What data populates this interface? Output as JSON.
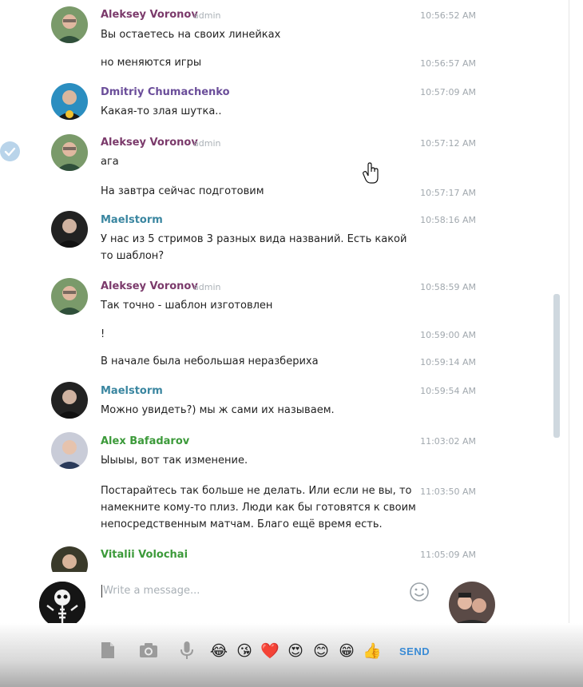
{
  "colors": {
    "author_purple": "#7b3a6b",
    "author_violet": "#6b4e9a",
    "author_teal": "#3a86a0",
    "author_green": "#3c9a3a",
    "time_gray": "#a1a8ae",
    "accent_blue": "#3a8bd5"
  },
  "messages": [
    {
      "author": "Aleksey Voronov",
      "role": "admin",
      "time": "10:56:52 AM",
      "text": "Вы остаетесь на своих линейках"
    },
    {
      "time": "10:56:57 AM",
      "text": "но меняются игры"
    },
    {
      "author": "Dmitriy Chumachenko",
      "time": "10:57:09 AM",
      "text": "Какая-то злая шутка.."
    },
    {
      "author": "Aleksey Voronov",
      "role": "admin",
      "time": "10:57:12 AM",
      "text": "ага"
    },
    {
      "time": "10:57:17 AM",
      "text": "На завтра сейчас подготовим"
    },
    {
      "author": "Maelstorm",
      "time": "10:58:16 AM",
      "text": "У нас из 5 стримов 3 разных вида названий. Есть какой то шаблон?"
    },
    {
      "author": "Aleksey Voronov",
      "role": "admin",
      "time": "10:58:59 AM",
      "text": "Так точно - шаблон изготовлен"
    },
    {
      "time": "10:59:00 AM",
      "text": "!"
    },
    {
      "time": "10:59:14 AM",
      "text": "В начале была небольшая неразбериха"
    },
    {
      "author": "Maelstorm",
      "time": "10:59:54 AM",
      "text": "Можно увидеть?) мы ж сами их называем."
    },
    {
      "author": "Alex Bafadarov",
      "time": "11:03:02 AM",
      "text": "Ыыыы, вот так изменение."
    },
    {
      "time": "11:03:50 AM",
      "text": "Постарайтесь так больше не делать. Или если не вы, то намекните кому-то плиз. Люди как бы готовятся к своим непосредственным матчам. Благо ещё время есть."
    },
    {
      "author": "Vitalii Volochai",
      "time": "11:05:09 AM",
      "text": ""
    }
  ],
  "compose": {
    "placeholder": "Write a message...",
    "send_label": "SEND",
    "emojis": [
      "😂",
      "😘",
      "❤️",
      "😍",
      "😊",
      "😁",
      "👍"
    ]
  },
  "icons": [
    "document-icon",
    "camera-icon",
    "microphone-icon",
    "smiley-icon",
    "check-icon",
    "hand-cursor-icon"
  ]
}
